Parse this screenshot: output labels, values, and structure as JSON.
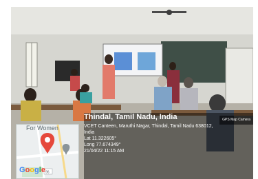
{
  "map": {
    "label": "For Women",
    "brand": "Google",
    "road_label": "96",
    "pin_color": "#e5483b"
  },
  "geotag": {
    "title": "Thindal, Tamil Nadu, India",
    "address_line1": "VCET Canteen, Maruthi Nagar, Thindal, Tamil Nadu 638012,",
    "address_line2": "India",
    "latitude": "Lat 11.322605°",
    "longitude": "Long 77.674349°",
    "datetime": "21/04/22 11:15 AM",
    "app_badge": "GPS Map Camera"
  },
  "scene": {
    "screen_slide_color": "#5b8fd6"
  }
}
